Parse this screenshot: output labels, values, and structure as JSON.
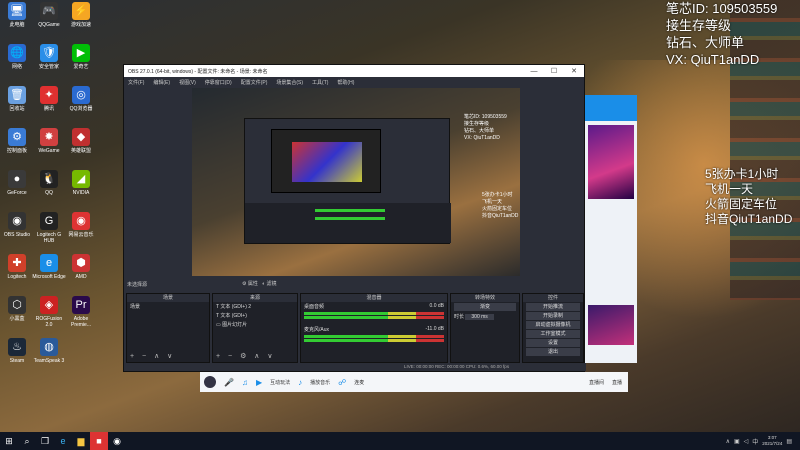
{
  "overlay": {
    "lines": [
      "笔芯ID: 109503559",
      "接生存等级",
      "钻石、大师单",
      "VX: QiuT1anDD"
    ],
    "right_lines": [
      "5张办卡1小时",
      "飞机一天",
      "火箭固定车位",
      "抖音QiuT1anDD"
    ]
  },
  "desktop_icons": [
    {
      "label": "此电脑",
      "glyph": "🖥",
      "color": "#3a7bd5"
    },
    {
      "label": "QQGame",
      "glyph": "🎮",
      "color": "#333"
    },
    {
      "label": "游戏加速",
      "glyph": "⚡",
      "color": "#f5a623"
    },
    {
      "label": "网络",
      "glyph": "🌐",
      "color": "#2a6ad0"
    },
    {
      "label": "安全管家",
      "glyph": "🛡",
      "color": "#2a8ee8"
    },
    {
      "label": "爱奇艺",
      "glyph": "▶",
      "color": "#00be06"
    },
    {
      "label": "回收站",
      "glyph": "🗑",
      "color": "#6aa0e0"
    },
    {
      "label": "腾讯",
      "glyph": "✦",
      "color": "#e03030"
    },
    {
      "label": "QQ浏览器",
      "glyph": "◎",
      "color": "#2a6ad0"
    },
    {
      "label": "控制面板",
      "glyph": "⚙",
      "color": "#3a7bd5"
    },
    {
      "label": "WeGame",
      "glyph": "✸",
      "color": "#d04040"
    },
    {
      "label": "英雄联盟",
      "glyph": "◆",
      "color": "#c03030"
    },
    {
      "label": "GeForce",
      "glyph": "●",
      "color": "#3a3a3a"
    },
    {
      "label": "QQ",
      "glyph": "🐧",
      "color": "#222"
    },
    {
      "label": "NVIDIA",
      "glyph": "◢",
      "color": "#76b900"
    },
    {
      "label": "OBS Studio",
      "glyph": "◉",
      "color": "#333"
    },
    {
      "label": "Logitech G HUB",
      "glyph": "G",
      "color": "#222"
    },
    {
      "label": "网易云音乐",
      "glyph": "◉",
      "color": "#d33"
    },
    {
      "label": "Logitech",
      "glyph": "✚",
      "color": "#d0402a"
    },
    {
      "label": "Microsoft Edge",
      "glyph": "e",
      "color": "#1a8ee8"
    },
    {
      "label": "AMD",
      "glyph": "⬢",
      "color": "#c33"
    },
    {
      "label": "小黑盒",
      "glyph": "⬡",
      "color": "#333"
    },
    {
      "label": "ROGFusion 2.0",
      "glyph": "◈",
      "color": "#c22"
    },
    {
      "label": "Adobe Premie...",
      "glyph": "Pr",
      "color": "#2a0a4a"
    },
    {
      "label": "Steam",
      "glyph": "♨",
      "color": "#1b2838"
    },
    {
      "label": "TeamSpeak 3",
      "glyph": "◍",
      "color": "#2a5a9a"
    }
  ],
  "obs": {
    "title": "OBS 27.0.1 (64-bit, windows) - 配置文件: 未命名 - 场景: 未命名",
    "menu": [
      "文件(F)",
      "编辑(E)",
      "视图(V)",
      "停靠窗口(D)",
      "配置文件(P)",
      "场景集合(S)",
      "工具(T)",
      "帮助(H)"
    ],
    "preview_text": [
      "笔芯ID: 109503559",
      "接生存等级",
      "钻石、大师单",
      "VX: QiuT1anDD"
    ],
    "preview_text2": [
      "5张办卡1小时",
      "飞机一天",
      "火箭固定车位",
      "抖音QiuT1anDD"
    ],
    "no_source_label": "未选择源",
    "props_label": "属性",
    "filters_label": "滤镜",
    "docks": {
      "scenes": {
        "title": "场景",
        "items": [
          "场景"
        ]
      },
      "sources": {
        "title": "来源",
        "items": [
          "文本 (GDI+) 2",
          "文本 (GDI+)",
          "图片幻灯片"
        ]
      },
      "mixer": {
        "title": "混音器",
        "tracks": [
          "桌面音频",
          "麦克风/Aux"
        ],
        "levels": [
          "0.0 dB",
          "-11.0 dB"
        ]
      },
      "transitions": {
        "title": "转场特效",
        "type": "渐变",
        "duration_label": "时长",
        "duration": "300 ms"
      },
      "controls": {
        "title": "控件",
        "buttons": [
          "开始推流",
          "开始录制",
          "启动虚拟摄像机",
          "工作室模式",
          "设置",
          "退出"
        ]
      }
    },
    "status": "LIVE: 00:00:00   REC: 00:00:00   CPU: 0.6%, 60.00 fps"
  },
  "livebar": {
    "items": [
      "互动玩法",
      "播放音乐",
      "连麦",
      "直播间",
      "直播"
    ]
  },
  "taskbar": {
    "time": "3:07",
    "date": "2021/7/24"
  }
}
